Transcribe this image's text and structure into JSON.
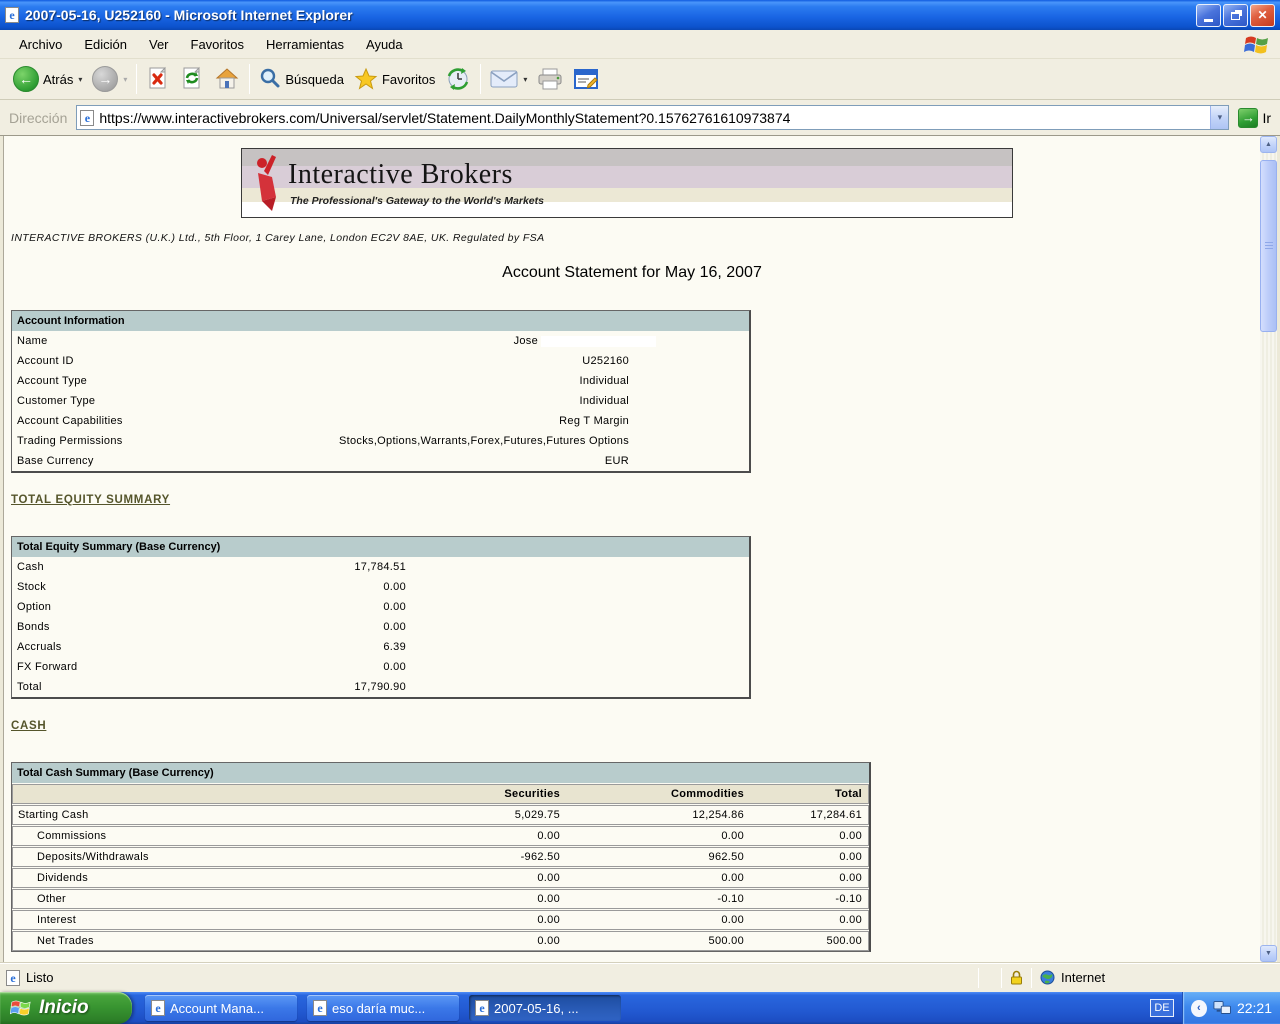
{
  "window": {
    "title": "2007-05-16, U252160 - Microsoft Internet Explorer",
    "menu": [
      "Archivo",
      "Edición",
      "Ver",
      "Favoritos",
      "Herramientas",
      "Ayuda"
    ],
    "toolbar": {
      "back_label": "Atrás",
      "search_label": "Búsqueda",
      "favorites_label": "Favoritos"
    },
    "address": {
      "label": "Dirección",
      "url": "https://www.interactivebrokers.com/Universal/servlet/Statement.DailyMonthlyStatement?0.15762761610973874",
      "go_label": "Ir"
    },
    "statusbar": {
      "ready": "Listo",
      "zone": "Internet"
    }
  },
  "icons": {
    "dropdown": "▾",
    "back_arrow": "←",
    "forward_arrow": "→",
    "go_arrow": "→",
    "scroll_up": "▲",
    "scroll_down": "▼",
    "chevron_left": "‹",
    "close": "✕"
  },
  "taskbar": {
    "start_label": "Inicio",
    "tasks": [
      {
        "label": "Account Mana..."
      },
      {
        "label": "eso daría muc..."
      },
      {
        "label": "2007-05-16, ..."
      }
    ],
    "language": "DE",
    "clock": "22:21"
  },
  "page": {
    "brand": {
      "name": "Interactive Brokers",
      "tagline": "The Professional's Gateway to the World's Markets"
    },
    "legal_line": "INTERACTIVE BROKERS (U.K.) Ltd., 5th Floor, 1 Carey Lane, London EC2V 8AE, UK. Regulated by FSA",
    "heading": "Account Statement for May 16, 2007",
    "account_info": {
      "title": "Account Information",
      "rows": [
        {
          "label": "Name",
          "value": "Jose"
        },
        {
          "label": "Account ID",
          "value": "U252160"
        },
        {
          "label": "Account Type",
          "value": "Individual"
        },
        {
          "label": "Customer Type",
          "value": "Individual"
        },
        {
          "label": "Account Capabilities",
          "value": "Reg T Margin"
        },
        {
          "label": "Trading Permissions",
          "value": "Stocks,Options,Warrants,Forex,Futures,Futures Options"
        },
        {
          "label": "Base Currency",
          "value": "EUR"
        }
      ]
    },
    "equity_link": "TOTAL EQUITY SUMMARY",
    "equity_summary": {
      "title": "Total Equity Summary (Base Currency)",
      "rows": [
        {
          "label": "Cash",
          "value": "17,784.51"
        },
        {
          "label": "Stock",
          "value": "0.00"
        },
        {
          "label": "Option",
          "value": "0.00"
        },
        {
          "label": "Bonds",
          "value": "0.00"
        },
        {
          "label": "Accruals",
          "value": "6.39"
        },
        {
          "label": "FX Forward",
          "value": "0.00"
        },
        {
          "label": "Total",
          "value": "17,790.90"
        }
      ]
    },
    "cash_link": "CASH",
    "cash_summary": {
      "title": "Total Cash Summary (Base Currency)",
      "columns": [
        "Securities",
        "Commodities",
        "Total"
      ],
      "rows": [
        {
          "label": "Starting Cash",
          "securities": "5,029.75",
          "commodities": "12,254.86",
          "total": "17,284.61"
        },
        {
          "label": "Commissions",
          "securities": "0.00",
          "commodities": "0.00",
          "total": "0.00"
        },
        {
          "label": "Deposits/Withdrawals",
          "securities": "-962.50",
          "commodities": "962.50",
          "total": "0.00"
        },
        {
          "label": "Dividends",
          "securities": "0.00",
          "commodities": "0.00",
          "total": "0.00"
        },
        {
          "label": "Other",
          "securities": "0.00",
          "commodities": "-0.10",
          "total": "-0.10"
        },
        {
          "label": "Interest",
          "securities": "0.00",
          "commodities": "0.00",
          "total": "0.00"
        },
        {
          "label": "Net Trades",
          "securities": "0.00",
          "commodities": "500.00",
          "total": "500.00"
        }
      ]
    }
  },
  "colors": {
    "titlebar_blue": "#1a66e4",
    "taskbar_blue": "#2259d1",
    "start_green": "#379330",
    "table_header_teal": "#b8cccc",
    "subheader_beige": "#e8e4d0",
    "link_olive": "#55552b",
    "page_background": "#fcfbf3"
  }
}
